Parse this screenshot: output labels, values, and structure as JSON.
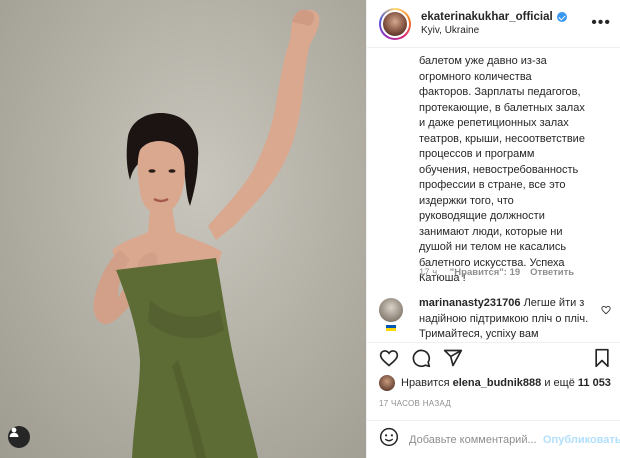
{
  "post": {
    "photo_description_icon": "user-tag-icon"
  },
  "header": {
    "username": "ekaterinakukhar_official",
    "location": "Kyiv, Ukraine",
    "more_label": "•••"
  },
  "caption": {
    "text": "балетом уже давно из-за\nогромного количества\nфакторов. Зарплаты педагогов,\nпротекающие, в балетных залах\nи даже репетиционных залах\nтеатров, крыши, несоответствие\nпроцессов и программ\nобучения, невостребованность\nпрофессии в стране, все это\nиздержки того, что\nруководящие должности\nзанимают люди, которые ни\nдушой ни телом не касались\nбалетного искусства. Успеха\nКатюша !",
    "time": "17 ч.",
    "likes": "\"Нравится\": 19",
    "reply": "Ответить"
  },
  "comment2": {
    "username": "marinanasty231706",
    "text": "Легше йти з надійною підтримкою пліч о пліч. Тримайтеся, успіху вам"
  },
  "actions": {
    "like_icon": "heart-icon",
    "comment_icon": "comment-icon",
    "share_icon": "share-icon",
    "save_icon": "bookmark-icon"
  },
  "likes": {
    "prefix": "Нравится",
    "user": "elena_budnik888",
    "middle": "и ещё",
    "count": "11 053"
  },
  "timestamp": "17 ЧАСОВ НАЗАД",
  "add_comment": {
    "placeholder": "Добавьте комментарий...",
    "publish_label": "Опубликовать"
  },
  "colors": {
    "accent": "#3897f0",
    "publish_disabled": "#b2dffc",
    "muted": "#8e8e8e",
    "dress": "#5d6b35"
  }
}
